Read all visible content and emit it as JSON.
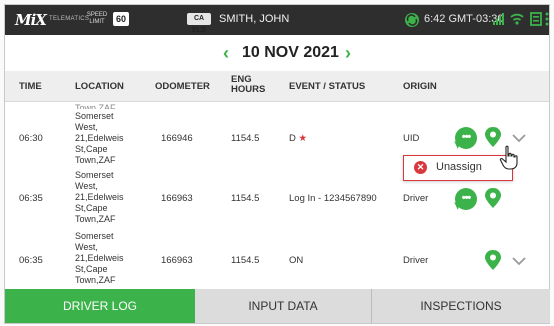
{
  "statusbar": {
    "logo": "MiX",
    "telematics": "TELEMATICS",
    "speed_label": "SPEED LIMIT",
    "speed_value": "60",
    "eld_badge": "CA ELD",
    "driver_name": "SMITH, JOHN",
    "time": "6:42 GMT-03:30"
  },
  "date_nav": {
    "date": "10 NOV 2021"
  },
  "table": {
    "headers": [
      "TIME",
      "LOCATION",
      "ODOMETER",
      "ENG HOURS",
      "EVENT / STATUS",
      "ORIGIN"
    ],
    "cut_row_text": "Town,ZAF",
    "rows": [
      {
        "time": "06:30",
        "location": [
          "Somerset",
          "West,",
          "21,Edelweis",
          "St,Cape",
          "Town,ZAF"
        ],
        "odometer": "166946",
        "eng_hours": "1154.5",
        "event": "D",
        "event_star": "★",
        "origin": "UID"
      },
      {
        "time": "06:35",
        "location": [
          "Somerset",
          "West,",
          "21,Edelweis",
          "St,Cape",
          "Town,ZAF"
        ],
        "odometer": "166963",
        "eng_hours": "1154.5",
        "event": "Log In - 1234567890",
        "origin": "Driver"
      },
      {
        "time": "06:35",
        "location": [
          "Somerset",
          "West,",
          "21,Edelweis",
          "St,Cape",
          "Town,ZAF"
        ],
        "odometer": "166963",
        "eng_hours": "1154.5",
        "event": "ON",
        "origin": "Driver"
      }
    ]
  },
  "popup": {
    "label": "Unassign"
  },
  "tabs": [
    "DRIVER LOG",
    "INPUT DATA",
    "INSPECTIONS"
  ],
  "colors": {
    "accent": "#3cb34a",
    "danger": "#d9363e",
    "statusbar": "#2e2e2e"
  },
  "icons": [
    "chat-icon",
    "location-pin-icon",
    "chevron-down-icon",
    "close-circle-icon",
    "hand-cursor-icon"
  ]
}
